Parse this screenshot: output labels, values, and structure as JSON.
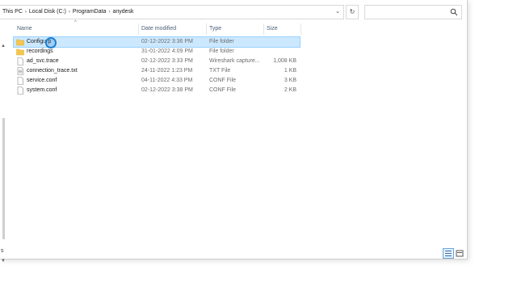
{
  "breadcrumb": [
    "This PC",
    "Local Disk (C:)",
    "ProgramData",
    "anydesk"
  ],
  "search": {
    "placeholder": ""
  },
  "columns": {
    "name": "Name",
    "date": "Date modified",
    "type": "Type",
    "size": "Size"
  },
  "files": [
    {
      "name": "Configurp",
      "date": "02-12-2022 3:36 PM",
      "type": "File folder",
      "size": "",
      "icon": "folder-icon",
      "selected": true
    },
    {
      "name": "recordings",
      "date": "31-01-2022 4:09 PM",
      "type": "File folder",
      "size": "",
      "icon": "folder-icon",
      "selected": false
    },
    {
      "name": "ad_svc.trace",
      "date": "02-12-2022 3:33 PM",
      "type": "Wireshark capture...",
      "size": "1,008 KB",
      "icon": "file-icon",
      "selected": false
    },
    {
      "name": "connection_trace.txt",
      "date": "24-11-2022 1:23 PM",
      "type": "TXT File",
      "size": "1 KB",
      "icon": "text-file-icon",
      "selected": false
    },
    {
      "name": "service.conf",
      "date": "04-11-2022 4:33 PM",
      "type": "CONF File",
      "size": "3 KB",
      "icon": "file-icon",
      "selected": false
    },
    {
      "name": "system.conf",
      "date": "02-12-2022 3:38 PM",
      "type": "CONF File",
      "size": "2 KB",
      "icon": "file-icon",
      "selected": false
    }
  ],
  "nav": {
    "more": "s"
  },
  "colors": {
    "selection": "#cce8ff",
    "header_text": "#4c607a",
    "folder": "#f5c84c"
  }
}
